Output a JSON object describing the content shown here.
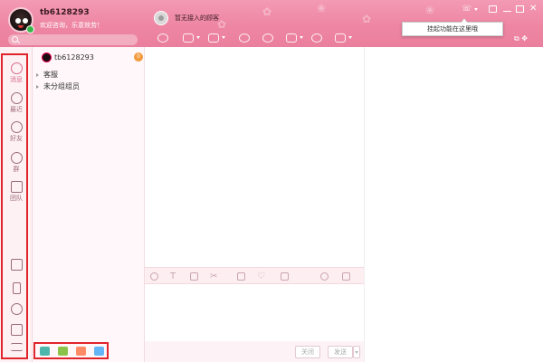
{
  "user": {
    "name": "tb6128293",
    "signature": "欢迎咨询，乐意效劳！"
  },
  "chat": {
    "contact_status": "暂无接入的顾客",
    "close_label": "关闭",
    "send_label": "发送"
  },
  "header": {
    "tooltip": "挂起功能在这里哦"
  },
  "nav": {
    "items": [
      {
        "label": "消息",
        "icon": "message-icon"
      },
      {
        "label": "最近",
        "icon": "clock-icon"
      },
      {
        "label": "好友",
        "icon": "person-icon"
      },
      {
        "label": "群",
        "icon": "group-icon"
      },
      {
        "label": "团队",
        "icon": "team-icon"
      }
    ],
    "bottom_icons": [
      "apps-grid-icon",
      "mobile-icon",
      "add-contact-icon",
      "inbox-icon",
      "menu-icon"
    ]
  },
  "contacts": {
    "self_name": "tb6128293",
    "badge": "0",
    "groups": [
      {
        "label": "客服"
      },
      {
        "label": "未分组组员"
      }
    ]
  },
  "colors": {
    "header": "#ee86a3",
    "highlight": "#e0242a",
    "badge": "#f29a3a"
  }
}
